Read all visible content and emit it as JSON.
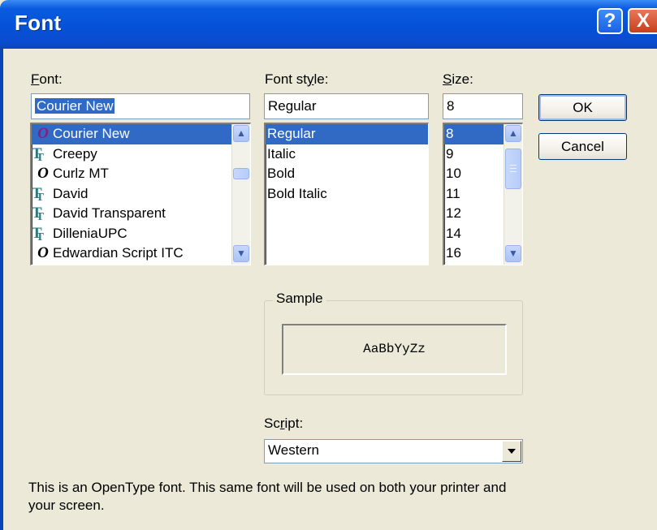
{
  "window": {
    "title": "Font",
    "help_glyph": "?",
    "close_glyph": "X"
  },
  "font": {
    "label_prefix": "",
    "label_accel": "F",
    "label_rest": "ont:",
    "value": "Courier New",
    "items": [
      {
        "icon": "opentype-icon",
        "glyph": "O",
        "name": "Courier New",
        "selected": true
      },
      {
        "icon": "truetype-icon",
        "glyph": "T",
        "name": "Creepy"
      },
      {
        "icon": "opentype-icon",
        "glyph": "O",
        "name": "Curlz MT"
      },
      {
        "icon": "truetype-icon",
        "glyph": "T",
        "name": "David"
      },
      {
        "icon": "truetype-icon",
        "glyph": "T",
        "name": "David Transparent"
      },
      {
        "icon": "truetype-icon",
        "glyph": "T",
        "name": "DilleniaUPC"
      },
      {
        "icon": "opentype-icon",
        "glyph": "O",
        "name": "Edwardian Script ITC"
      }
    ]
  },
  "style": {
    "label_prefix": "Font st",
    "label_accel": "y",
    "label_rest": "le:",
    "value": "Regular",
    "items": [
      {
        "name": "Regular",
        "selected": true
      },
      {
        "name": "Italic"
      },
      {
        "name": "Bold"
      },
      {
        "name": "Bold Italic"
      }
    ]
  },
  "size": {
    "label_prefix": "",
    "label_accel": "S",
    "label_rest": "ize:",
    "value": "8",
    "items": [
      {
        "name": "8",
        "selected": true
      },
      {
        "name": "9"
      },
      {
        "name": "10"
      },
      {
        "name": "11"
      },
      {
        "name": "12"
      },
      {
        "name": "14"
      },
      {
        "name": "16"
      }
    ]
  },
  "buttons": {
    "ok": "OK",
    "cancel": "Cancel"
  },
  "sample": {
    "label": "Sample",
    "text": "AaBbYyZz"
  },
  "script": {
    "label_prefix": "Sc",
    "label_accel": "r",
    "label_rest": "ipt:",
    "value": "Western"
  },
  "description": "This is an OpenType font. This same font will be used on both your printer and your screen."
}
